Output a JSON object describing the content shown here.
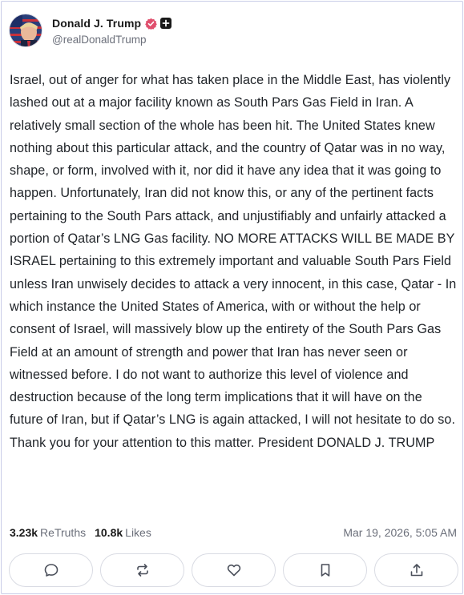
{
  "author": {
    "display_name": "Donald J. Trump",
    "handle": "@realDonaldTrump"
  },
  "post": {
    "text": "Israel, out of anger for what has taken place in the Middle East, has violently lashed out at a major facility known as South Pars Gas Field in Iran. A relatively small section of the whole has been hit. The United States knew nothing about this particular attack, and the country of Qatar was in no way, shape, or form, involved with it, nor did it have any idea that it was going to happen. Unfortunately, Iran did not know this, or any of the pertinent facts pertaining to the South Pars attack, and unjustifiably and unfairly attacked a portion of Qatar’s LNG Gas facility. NO MORE ATTACKS WILL BE MADE BY ISRAEL pertaining to this extremely important and valuable South Pars Field unless Iran unwisely decides to attack a very innocent, in this case, Qatar - In which instance the United States of America, with or without the help or consent of Israel, will massively blow up the entirety of the South Pars Gas Field at an amount of strength and power that Iran has never seen or witnessed before. I do not want to authorize this level of violence and destruction because of the long term implications that it will have on the future of Iran, but if Qatar’s LNG is again attacked, I will not hesitate to do so. Thank you for your attention to this matter. President DONALD J. TRUMP"
  },
  "stats": {
    "retruths_count": "3.23k",
    "retruths_label": "ReTruths",
    "likes_count": "10.8k",
    "likes_label": "Likes",
    "timestamp": "Mar 19, 2026, 5:05 AM"
  },
  "icons": {
    "avatar": "avatar-image",
    "verified": "verified-badge-icon",
    "plus": "plus-badge-icon",
    "reply": "reply-icon",
    "retruth": "retruth-icon",
    "like": "heart-icon",
    "bookmark": "bookmark-icon",
    "share": "share-icon"
  },
  "colors": {
    "verified_badge": "#e0506e",
    "text_primary": "#1f2328",
    "text_secondary": "#6b6f7a",
    "border": "#d9dbe3"
  }
}
